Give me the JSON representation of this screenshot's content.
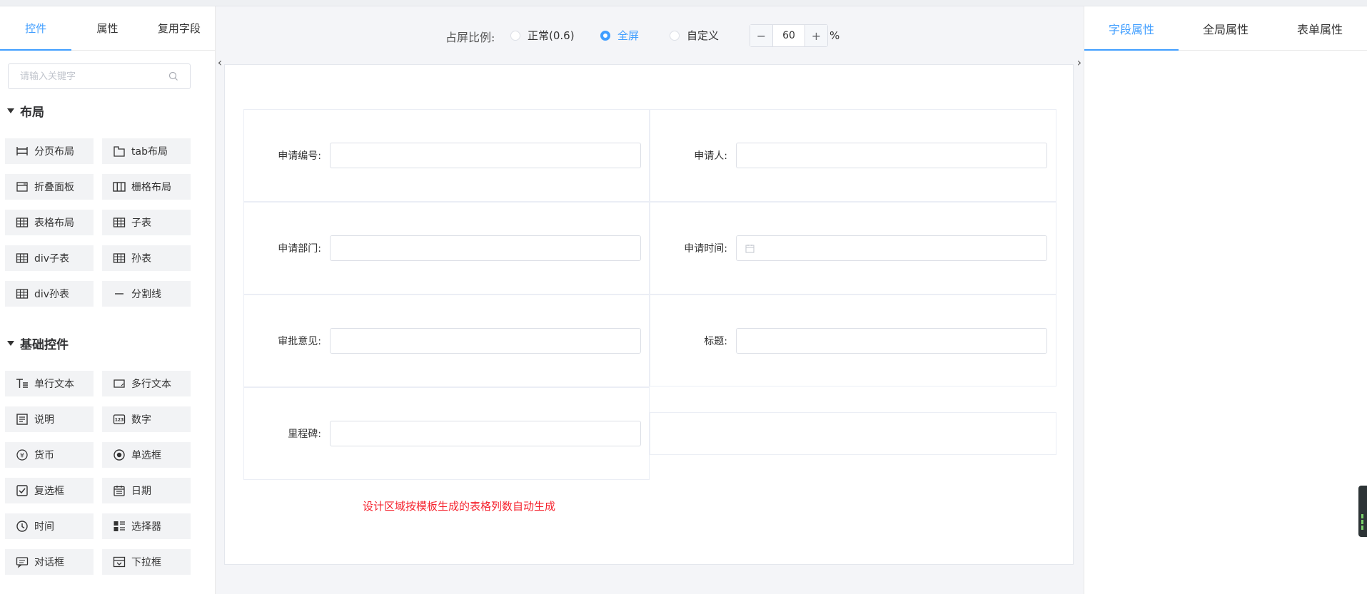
{
  "left_panel": {
    "tabs": [
      {
        "label": "控件"
      },
      {
        "label": "属性"
      },
      {
        "label": "复用字段"
      }
    ],
    "search": {
      "placeholder": "请输入关键字"
    },
    "layout_section": {
      "title": "布局",
      "items": [
        {
          "label": "分页布局",
          "icon": "page-layout-icon"
        },
        {
          "label": "tab布局",
          "icon": "tab-layout-icon"
        },
        {
          "label": "折叠面板",
          "icon": "collapse-panel-icon"
        },
        {
          "label": "栅格布局",
          "icon": "grid-layout-icon"
        },
        {
          "label": "表格布局",
          "icon": "table-layout-icon"
        },
        {
          "label": "子表",
          "icon": "sub-table-icon"
        },
        {
          "label": "div子表",
          "icon": "div-sub-table-icon"
        },
        {
          "label": "孙表",
          "icon": "grandchild-table-icon"
        },
        {
          "label": "div孙表",
          "icon": "div-grandchild-table-icon"
        },
        {
          "label": "分割线",
          "icon": "divider-icon"
        }
      ]
    },
    "basic_section": {
      "title": "基础控件",
      "items": [
        {
          "label": "单行文本",
          "icon": "single-line-text-icon"
        },
        {
          "label": "多行文本",
          "icon": "multi-line-text-icon"
        },
        {
          "label": "说明",
          "icon": "description-icon"
        },
        {
          "label": "数字",
          "icon": "number-icon"
        },
        {
          "label": "货币",
          "icon": "currency-icon"
        },
        {
          "label": "单选框",
          "icon": "radio-icon"
        },
        {
          "label": "复选框",
          "icon": "checkbox-icon"
        },
        {
          "label": "日期",
          "icon": "date-icon"
        },
        {
          "label": "时间",
          "icon": "time-icon"
        },
        {
          "label": "选择器",
          "icon": "selector-icon"
        },
        {
          "label": "对话框",
          "icon": "dialog-icon"
        },
        {
          "label": "下拉框",
          "icon": "dropdown-icon"
        }
      ]
    }
  },
  "toolbar": {
    "ratio_label": "占屏比例:",
    "options": [
      {
        "label": "正常(0.6)",
        "selected": false
      },
      {
        "label": "全屏",
        "selected": true
      },
      {
        "label": "自定义",
        "selected": false
      }
    ],
    "stepper": {
      "minus": "−",
      "value": "60",
      "plus": "+"
    },
    "unit": "%"
  },
  "form": {
    "fields": [
      {
        "label": "申请编号:",
        "value": ""
      },
      {
        "label": "申请人:",
        "value": ""
      },
      {
        "label": "申请部门:",
        "value": ""
      },
      {
        "label": "申请时间:",
        "value": "",
        "icon": "calendar-icon"
      },
      {
        "label": "审批意见:",
        "value": ""
      },
      {
        "label": "标题:",
        "value": ""
      },
      {
        "label": "里程碑:",
        "value": ""
      }
    ],
    "hint": "设计区域按模板生成的表格列数自动生成"
  },
  "right_panel": {
    "tabs": [
      {
        "label": "字段属性"
      },
      {
        "label": "全局属性"
      },
      {
        "label": "表单属性"
      }
    ]
  },
  "colors": {
    "accent": "#409eff",
    "hint": "#f5222d"
  }
}
